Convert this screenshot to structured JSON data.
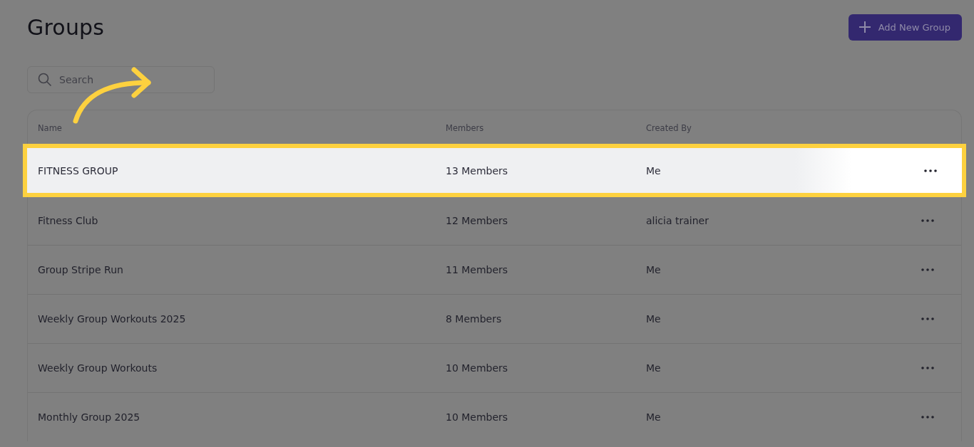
{
  "title": "Groups",
  "add_button": {
    "label": "Add New Group"
  },
  "search": {
    "placeholder": "Search"
  },
  "table": {
    "columns": [
      "Name",
      "Members",
      "Created By"
    ],
    "rows": [
      {
        "name": "FITNESS GROUP",
        "members": "13 Members",
        "created_by": "Me",
        "selected": true
      },
      {
        "name": "Fitness Club",
        "members": "12 Members",
        "created_by": "alicia trainer",
        "selected": false
      },
      {
        "name": "Group Stripe Run",
        "members": "11 Members",
        "created_by": "Me",
        "selected": false
      },
      {
        "name": "Weekly Group Workouts 2025",
        "members": "8 Members",
        "created_by": "Me",
        "selected": false
      },
      {
        "name": "Weekly Group Workouts",
        "members": "10 Members",
        "created_by": "Me",
        "selected": false
      },
      {
        "name": "Monthly Group 2025",
        "members": "10 Members",
        "created_by": "Me",
        "selected": false
      }
    ]
  }
}
